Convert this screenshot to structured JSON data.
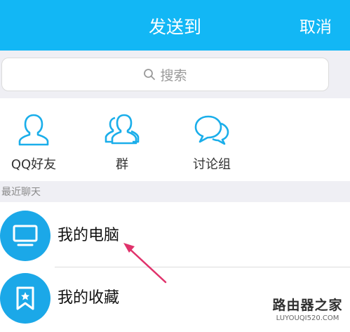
{
  "header": {
    "title": "发送到",
    "cancel_label": "取消"
  },
  "search": {
    "placeholder": "搜索"
  },
  "shortcuts": [
    {
      "label": "QQ好友",
      "icon": "person-icon"
    },
    {
      "label": "群",
      "icon": "group-icon"
    },
    {
      "label": "讨论组",
      "icon": "discussion-icon"
    }
  ],
  "recent": {
    "section_label": "最近聊天",
    "items": [
      {
        "name": "我的电脑",
        "icon": "computer-icon"
      },
      {
        "name": "我的收藏",
        "icon": "favorites-icon"
      }
    ]
  },
  "watermark": {
    "main": "路由器之家",
    "sub": "LUYOUQI520.COM"
  },
  "colors": {
    "header_bg": "#12b7f5",
    "avatar_bg": "#1ba8e8",
    "icon_stroke": "#1aaeea",
    "annotation_arrow": "#e0326b"
  }
}
